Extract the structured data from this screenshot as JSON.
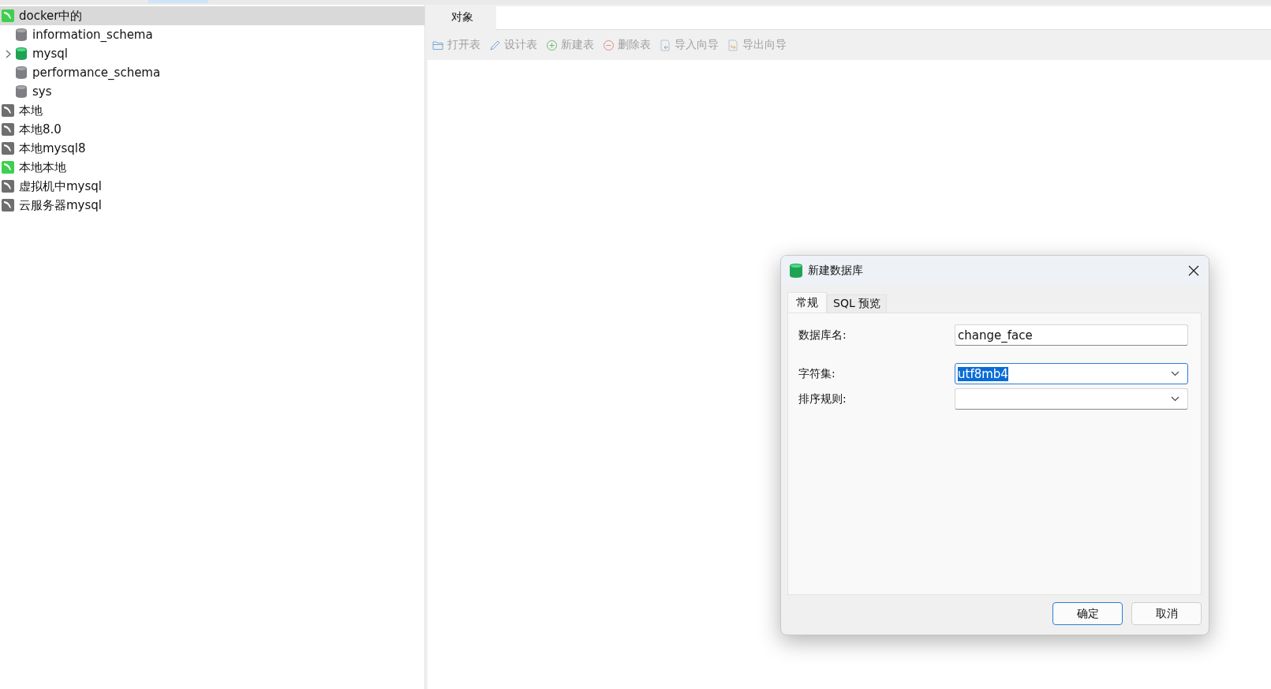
{
  "connections": [
    {
      "name": "docker中的",
      "connected": true,
      "selected": true,
      "databases": [
        {
          "name": "information_schema",
          "open": false,
          "expandable": false
        },
        {
          "name": "mysql",
          "open": true,
          "expandable": true
        },
        {
          "name": "performance_schema",
          "open": false,
          "expandable": false
        },
        {
          "name": "sys",
          "open": false,
          "expandable": false
        }
      ]
    },
    {
      "name": "本地",
      "connected": false,
      "selected": false
    },
    {
      "name": "本地8.0",
      "connected": false,
      "selected": false
    },
    {
      "name": "本地mysql8",
      "connected": false,
      "selected": false
    },
    {
      "name": "本地本地",
      "connected": true,
      "selected": false
    },
    {
      "name": "虚拟机中mysql",
      "connected": false,
      "selected": false
    },
    {
      "name": "云服务器mysql",
      "connected": false,
      "selected": false
    }
  ],
  "main_tabs": [
    {
      "label": "对象",
      "selected": true
    }
  ],
  "toolbar": [
    {
      "label": "打开表",
      "kind": "open",
      "disabled": true
    },
    {
      "label": "设计表",
      "kind": "design",
      "disabled": true
    },
    {
      "label": "新建表",
      "kind": "new",
      "disabled": true
    },
    {
      "label": "删除表",
      "kind": "delete",
      "disabled": true
    },
    {
      "label": "导入向导",
      "kind": "import",
      "disabled": true
    },
    {
      "label": "导出向导",
      "kind": "export",
      "disabled": true
    }
  ],
  "dialog": {
    "title": "新建数据库",
    "tabs": [
      {
        "label": "常规",
        "selected": true
      },
      {
        "label": "SQL 预览",
        "selected": false
      }
    ],
    "fields": [
      {
        "label": "数据库名:",
        "kind": "text",
        "value": "change_face",
        "focused": false
      },
      {
        "label": "字符集:",
        "kind": "select",
        "value": "utf8mb4",
        "focused": true
      },
      {
        "label": "排序规则:",
        "kind": "select",
        "focused": false
      }
    ],
    "buttons": [
      {
        "label": "确定",
        "default": true
      },
      {
        "label": "取消",
        "default": false
      }
    ]
  }
}
